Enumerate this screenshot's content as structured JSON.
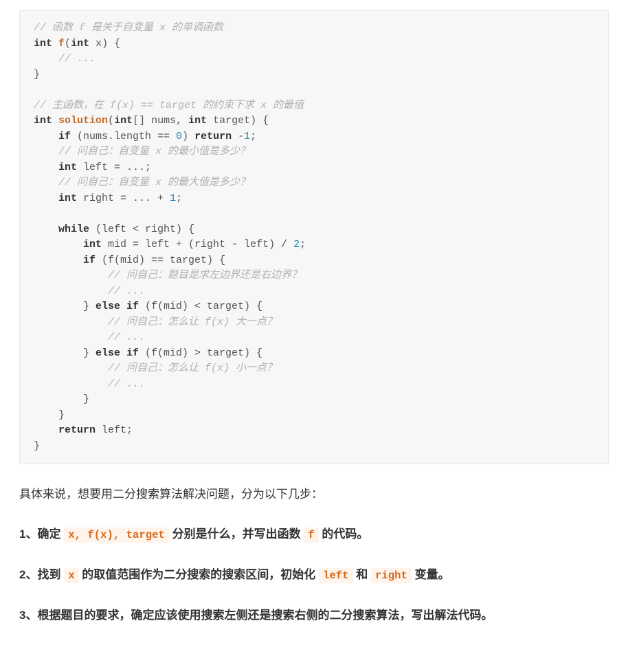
{
  "code": {
    "l1": "// 函数 f 是关于自变量 x 的单调函数",
    "l2_kw1": "int",
    "l2_fn": "f",
    "l2_rest1": "(",
    "l2_kw2": "int",
    "l2_rest2": " x) {",
    "l3": "    // ...",
    "l4": "}",
    "l5": "",
    "l6": "// 主函数，在 f(x) == target 的约束下求 x 的最值",
    "l7_kw1": "int",
    "l7_fn": "solution",
    "l7_rest1": "(",
    "l7_kw2": "int",
    "l7_rest2": "[] nums, ",
    "l7_kw3": "int",
    "l7_rest3": " target) {",
    "l8_pre": "    ",
    "l8_kw": "if",
    "l8_rest1": " (nums.length == ",
    "l8_num": "0",
    "l8_rest2": ") ",
    "l8_kw2": "return",
    "l8_rest3": " -",
    "l8_num2": "1",
    "l8_rest4": ";",
    "l9": "    // 问自己：自变量 x 的最小值是多少？",
    "l10_pre": "    ",
    "l10_kw": "int",
    "l10_rest": " left = ...;",
    "l11": "    // 问自己：自变量 x 的最大值是多少？",
    "l12_pre": "    ",
    "l12_kw": "int",
    "l12_rest1": " right = ... + ",
    "l12_num": "1",
    "l12_rest2": ";",
    "l13": "",
    "l14_pre": "    ",
    "l14_kw": "while",
    "l14_rest": " (left < right) {",
    "l15_pre": "        ",
    "l15_kw": "int",
    "l15_rest1": " mid = left + (right - left) / ",
    "l15_num": "2",
    "l15_rest2": ";",
    "l16_pre": "        ",
    "l16_kw": "if",
    "l16_rest": " (f(mid) == target) {",
    "l17": "            // 问自己：题目是求左边界还是右边界？",
    "l18": "            // ...",
    "l19_pre": "        } ",
    "l19_kw": "else if",
    "l19_rest": " (f(mid) < target) {",
    "l20": "            // 问自己：怎么让 f(x) 大一点？",
    "l21": "            // ...",
    "l22_pre": "        } ",
    "l22_kw": "else if",
    "l22_rest": " (f(mid) > target) {",
    "l23": "            // 问自己：怎么让 f(x) 小一点？",
    "l24": "            // ...",
    "l25": "        }",
    "l26": "    }",
    "l27_pre": "    ",
    "l27_kw": "return",
    "l27_rest": " left;",
    "l28": "}"
  },
  "text": {
    "intro": "具体来说，想要用二分搜索算法解决问题，分为以下几步：",
    "step1_a": "1、确定 ",
    "step1_code1": "x, f(x), target",
    "step1_b": " 分别是什么，并写出函数 ",
    "step1_code2": "f",
    "step1_c": " 的代码。",
    "step2_a": "2、找到 ",
    "step2_code1": "x",
    "step2_b": " 的取值范围作为二分搜索的搜索区间，初始化 ",
    "step2_code2": "left",
    "step2_c": " 和 ",
    "step2_code3": "right",
    "step2_d": " 变量。",
    "step3": "3、根据题目的要求，确定应该使用搜索左侧还是搜索右侧的二分搜索算法，写出解法代码。"
  }
}
